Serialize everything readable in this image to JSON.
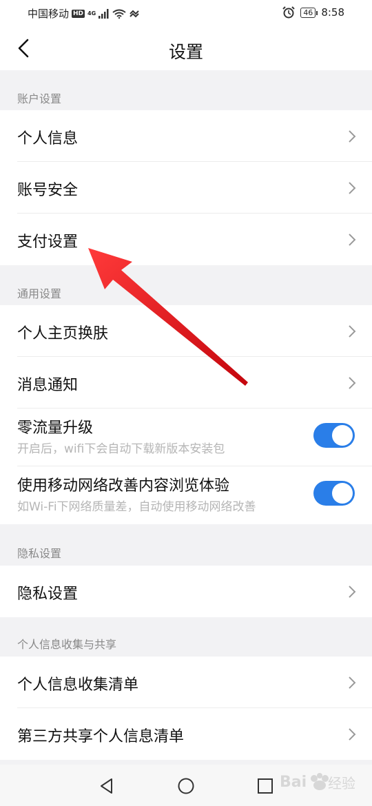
{
  "status_bar": {
    "carrier": "中国移动",
    "hd": "HD",
    "network": "4G",
    "battery": "46",
    "time": "8:58"
  },
  "nav": {
    "title": "设置"
  },
  "sections": {
    "account": {
      "header": "账户设置",
      "items": [
        "个人信息",
        "账号安全",
        "支付设置"
      ]
    },
    "general": {
      "header": "通用设置",
      "items": [
        "个人主页换肤",
        "消息通知"
      ],
      "toggles": [
        {
          "label": "零流量升级",
          "sub": "开启后，wifi下会自动下载新版本安装包",
          "on": true
        },
        {
          "label": "使用移动网络改善内容浏览体验",
          "sub": "如Wi-Fi下网络质量差，自动使用移动网络改善",
          "on": true
        }
      ]
    },
    "privacy": {
      "header": "隐私设置",
      "items": [
        "隐私设置"
      ]
    },
    "info_sharing": {
      "header": "个人信息收集与共享",
      "items": [
        "个人信息收集清单",
        "第三方共享个人信息清单"
      ]
    }
  },
  "icons": {
    "back": "back-arrow-icon",
    "chevron": "chevron-right-icon",
    "nav_back": "triangle-back-icon",
    "nav_home": "circle-home-icon",
    "nav_recents": "square-recents-icon"
  },
  "colors": {
    "toggle_on": "#2a7ee8",
    "annotation_arrow": "#e8141c"
  },
  "watermark_text": "Bai 经验"
}
